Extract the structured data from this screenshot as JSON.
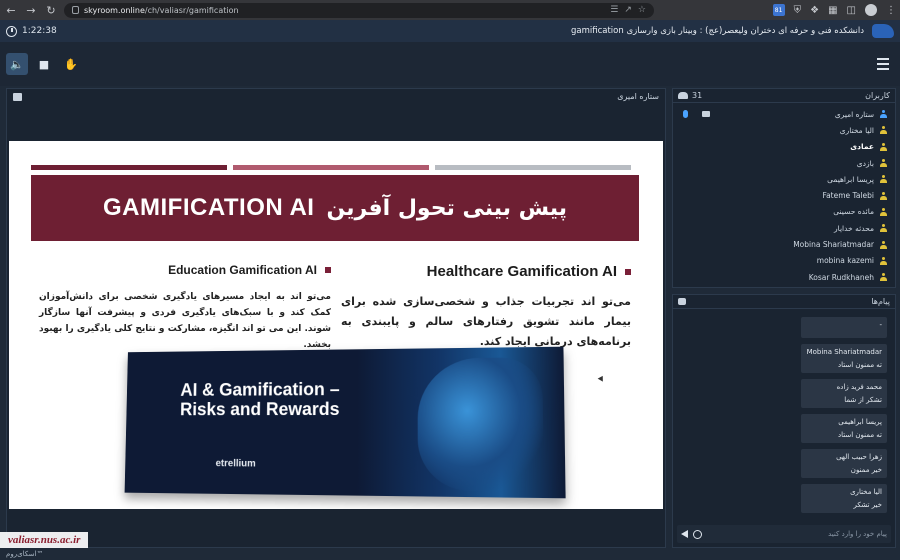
{
  "browser": {
    "url_host": "skyroom.online",
    "url_path": "/ch/valiasr/gamification",
    "ext_badge": "81"
  },
  "header": {
    "timer": "1:22:38",
    "room_title": "دانشکده فنی و حرفه ای دختران ولیعصر(عج) : وبینار بازی وارسازی gamification"
  },
  "video": {
    "presenter": "ستاره امیری"
  },
  "slide": {
    "stripe_colors": [
      "#6e1f33",
      "#b05a6e",
      "#b8bcc2"
    ],
    "title_en": "GAMIFICATION AI",
    "title_fa": "پیش بینی تحول آفرین",
    "left_heading": "Education Gamification AI",
    "left_text": "می‌تو اند به ایجاد مسیرهای یادگیری شخصی برای دانش‌آموزان کمک کند و با سبک‌های یادگیری فردی و پیشرفت آنها سازگار شوند. این می تو اند انگیزه، مشارکت و نتایج کلی یادگیری را بهبود بخشد.",
    "right_heading": "Healthcare Gamification AI",
    "right_text": "می‌تو اند تجربیات جذاب و شخصی‌سازی شده برای بیمار مانند تشویق رفتارهای سالم و پایبندی به برنامه‌های درمانی ایجاد کند.",
    "promo_title": "AI & Gamification – Risks and Rewards",
    "promo_brand": "etrellium"
  },
  "users": {
    "count": "31",
    "title": "کاربران",
    "list": [
      {
        "name": "ستاره امیری",
        "role": "admin",
        "bold": false
      },
      {
        "name": "الیا مختاری",
        "role": "user",
        "bold": false
      },
      {
        "name": "عمادی",
        "role": "user",
        "bold": true
      },
      {
        "name": "بازدی",
        "role": "user",
        "bold": false
      },
      {
        "name": "پریسا ابراهیمی",
        "role": "user",
        "bold": false
      },
      {
        "name": "Fateme Talebi",
        "role": "user",
        "bold": false
      },
      {
        "name": "مائده حسینی",
        "role": "user",
        "bold": false
      },
      {
        "name": "محدثه خدایار",
        "role": "user",
        "bold": false
      },
      {
        "name": "Mobina Shariatmadar",
        "role": "user",
        "bold": false
      },
      {
        "name": "mobina kazemi",
        "role": "user",
        "bold": false
      },
      {
        "name": "Kosar Rudkhaneh",
        "role": "user",
        "bold": false
      }
    ]
  },
  "chat": {
    "title": "پیام‌ها",
    "messages": [
      {
        "sender": "-",
        "text": ""
      },
      {
        "sender": "Mobina Shariatmadar",
        "text": "ته ممنون استاد"
      },
      {
        "sender": "محمد فرید زاده",
        "text": "تشکر از شما"
      },
      {
        "sender": "پریسا ابراهیمی",
        "text": "ته ممنون استاد"
      },
      {
        "sender": "زهرا حبیب الهی",
        "text": "خیر ممنون"
      },
      {
        "sender": "الیا مختاری",
        "text": "خیر تشکر"
      }
    ],
    "placeholder": "پیام خود را وارد کنید"
  },
  "footer": {
    "brand": "اسکای‌روم™"
  },
  "watermark": "valiasr.nus.ac.ir"
}
